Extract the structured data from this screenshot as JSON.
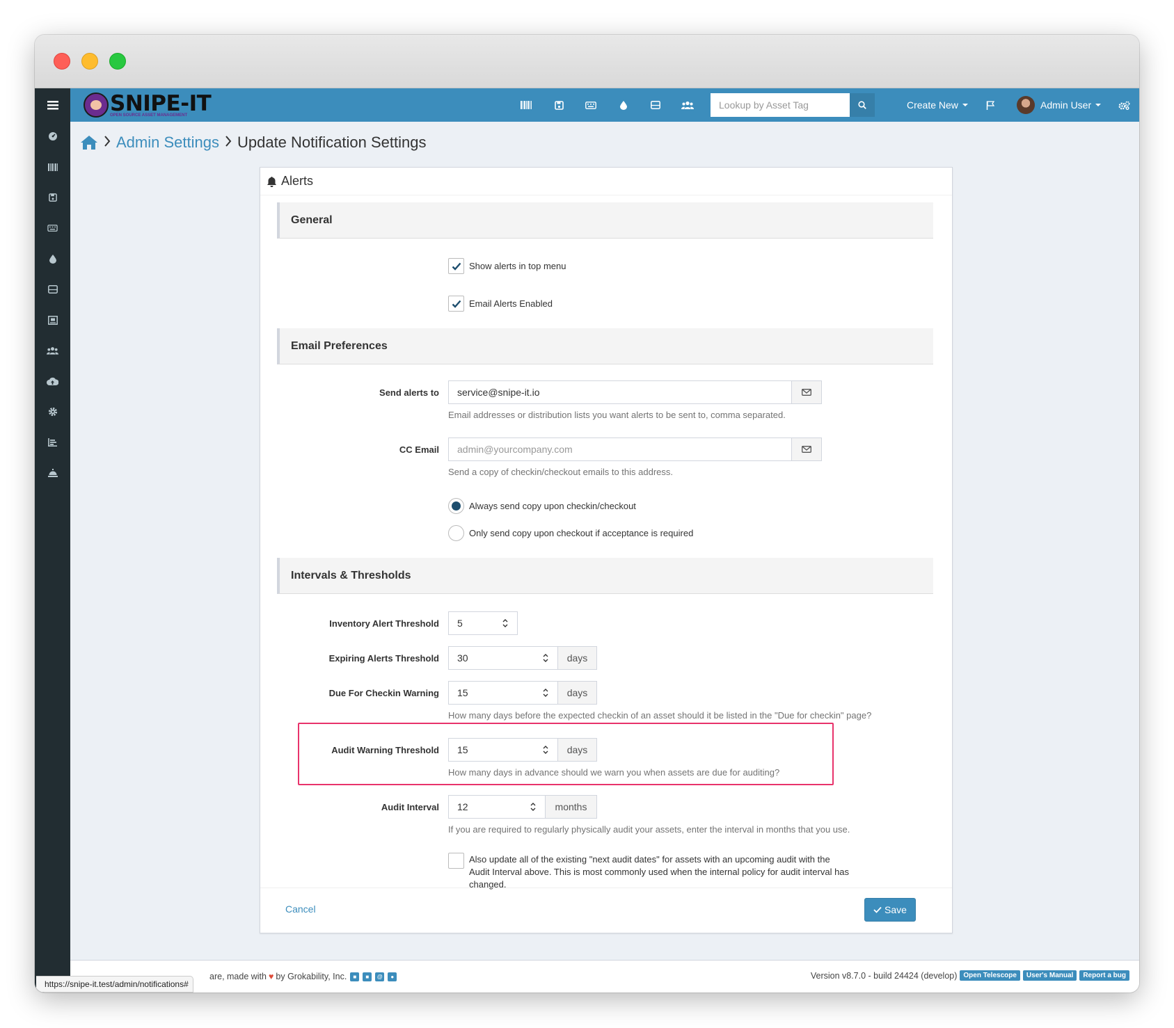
{
  "app": {
    "logo_text": "SNIPE-IT",
    "logo_subtext": "OPEN SOURCE ASSET MANAGEMENT"
  },
  "topnav": {
    "search_placeholder": "Lookup by Asset Tag",
    "create_new": "Create New",
    "user_name": "Admin User",
    "icons": [
      "barcode-icon",
      "save-icon",
      "keyboard-icon",
      "tint-icon",
      "hdd-icon",
      "users-icon"
    ]
  },
  "sidebar": {
    "icons": [
      "dashboard-icon",
      "barcode-icon",
      "save-icon",
      "keyboard-icon",
      "tint-icon",
      "hdd-icon",
      "components-icon",
      "users-icon",
      "cloud-upload-icon",
      "gear-icon",
      "reports-icon",
      "bell-concierge-icon"
    ]
  },
  "breadcrumb": {
    "parent": "Admin Settings",
    "current": "Update Notification Settings"
  },
  "panel": {
    "title": "Alerts"
  },
  "general": {
    "heading": "General",
    "show_alerts_label": "Show alerts in top menu",
    "show_alerts_checked": true,
    "email_alerts_label": "Email Alerts Enabled",
    "email_alerts_checked": true
  },
  "email_prefs": {
    "heading": "Email Preferences",
    "send_to_label": "Send alerts to",
    "send_to_value": "service@snipe-it.io",
    "send_to_help": "Email addresses or distribution lists you want alerts to be sent to, comma separated.",
    "cc_label": "CC Email",
    "cc_placeholder": "admin@yourcompany.com",
    "cc_help": "Send a copy of checkin/checkout emails to this address.",
    "radio_always": "Always send copy upon checkin/checkout",
    "radio_only": "Only send copy upon checkout if acceptance is required",
    "selected": "always"
  },
  "intervals": {
    "heading": "Intervals & Thresholds",
    "inventory_label": "Inventory Alert Threshold",
    "inventory_value": "5",
    "expiring_label": "Expiring Alerts Threshold",
    "expiring_value": "30",
    "expiring_unit": "days",
    "checkin_label": "Due For Checkin Warning",
    "checkin_value": "15",
    "checkin_unit": "days",
    "checkin_help": "How many days before the expected checkin of an asset should it be listed in the \"Due for checkin\" page?",
    "audit_warn_label": "Audit Warning Threshold",
    "audit_warn_value": "15",
    "audit_warn_unit": "days",
    "audit_warn_help": "How many days in advance should we warn you when assets are due for auditing?",
    "audit_interval_label": "Audit Interval",
    "audit_interval_value": "12",
    "audit_interval_unit": "months",
    "audit_interval_help": "If you are required to regularly physically audit your assets, enter the interval in months that you use.",
    "update_dates_line1": "Also update all of the existing \"next audit dates\" for assets with an upcoming audit with the",
    "update_dates_line2": "Audit Interval above. This is most commonly used when the internal policy for audit interval has",
    "update_dates_line3": "changed.",
    "update_dates_checked": false
  },
  "actions": {
    "cancel": "Cancel",
    "save": "Save"
  },
  "footer": {
    "url_hover": "https://snipe-it.test/admin/notifications#",
    "made_with_prefix": "are, made with",
    "made_with_suffix": "by Grokability, Inc.",
    "version": "Version v8.7.0 - build 24424 (develop)",
    "badge_telescope": "Open Telescope",
    "badge_manual": "User's Manual",
    "badge_bug": "Report a bug"
  },
  "colors": {
    "brand": "#3c8dbc",
    "sidebar": "#222d32",
    "highlight": "#e8336b"
  }
}
